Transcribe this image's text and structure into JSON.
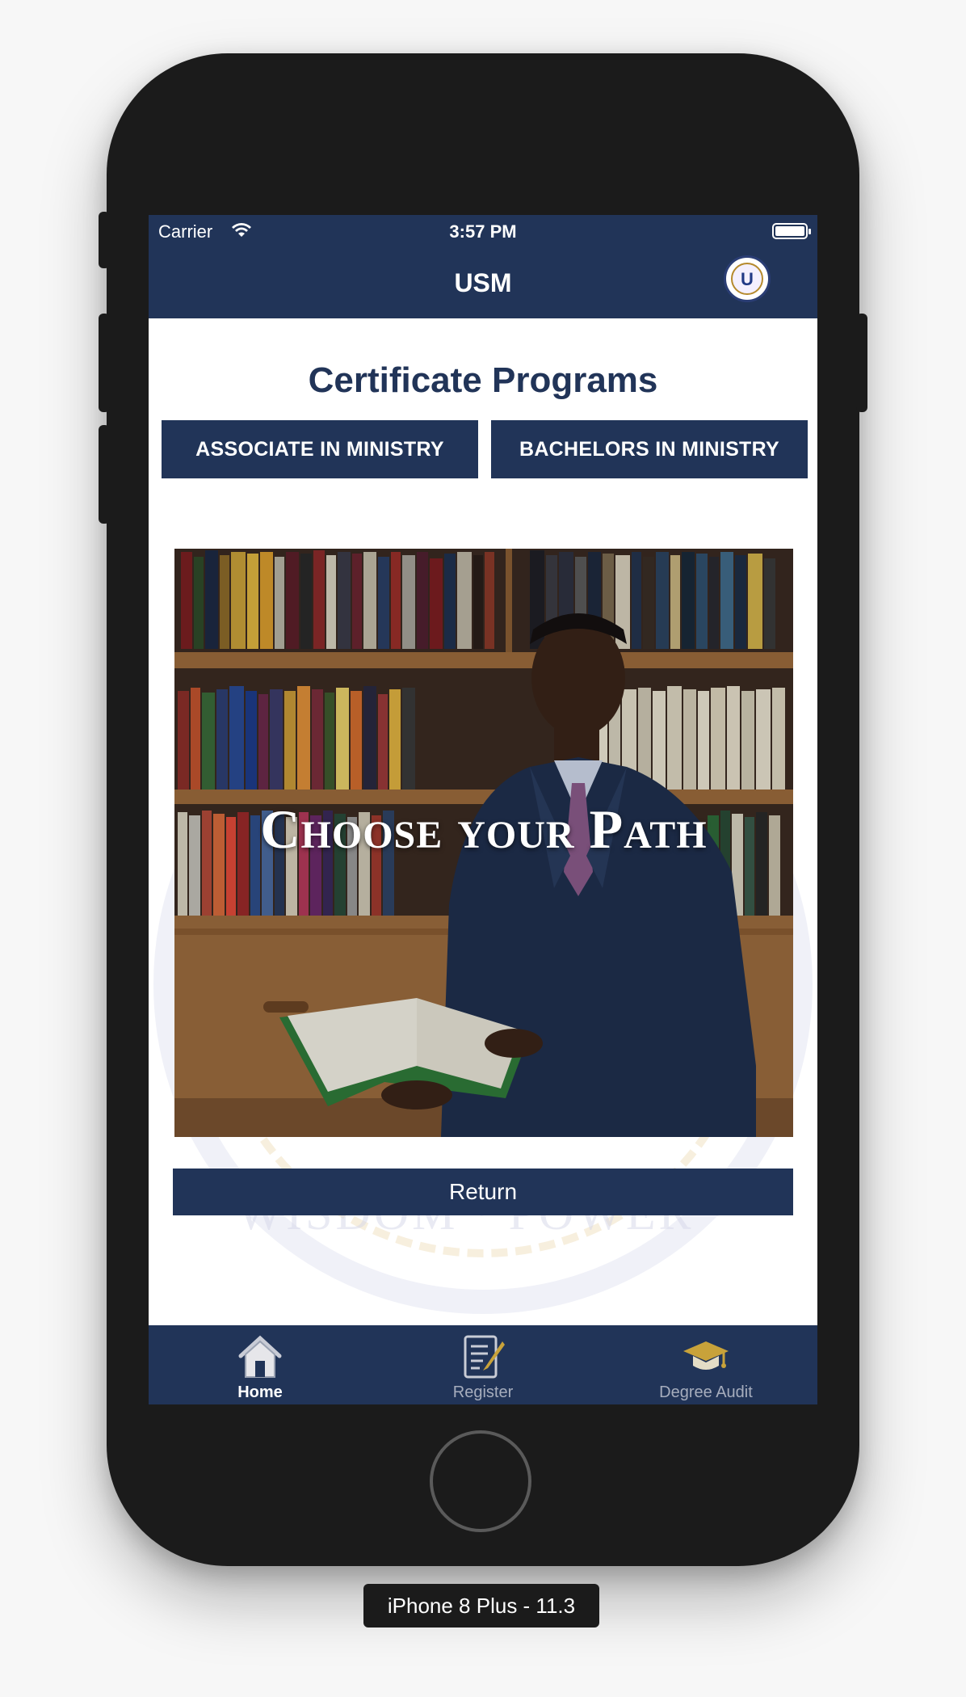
{
  "status_bar": {
    "carrier": "Carrier",
    "time": "3:57 PM"
  },
  "nav": {
    "title": "USM"
  },
  "page": {
    "title": "Certificate Programs",
    "associate_label": "ASSOCIATE IN MINISTRY",
    "bachelors_label": "BACHELORS IN MINISTRY",
    "hero_caption": "Choose your Path",
    "return_label": "Return",
    "watermark_motto": "WISDOM · POWER ·"
  },
  "tabs": [
    {
      "label": "Home",
      "icon": "home-icon",
      "active": true
    },
    {
      "label": "Register",
      "icon": "register-icon",
      "active": false
    },
    {
      "label": "Degree Audit",
      "icon": "graduation-cap-icon",
      "active": false
    }
  ],
  "device": {
    "label": "iPhone 8 Plus - 11.3"
  },
  "colors": {
    "brand_navy": "#213458",
    "accent_gold": "#c8a23a",
    "inactive_tab": "#a6adbd"
  }
}
